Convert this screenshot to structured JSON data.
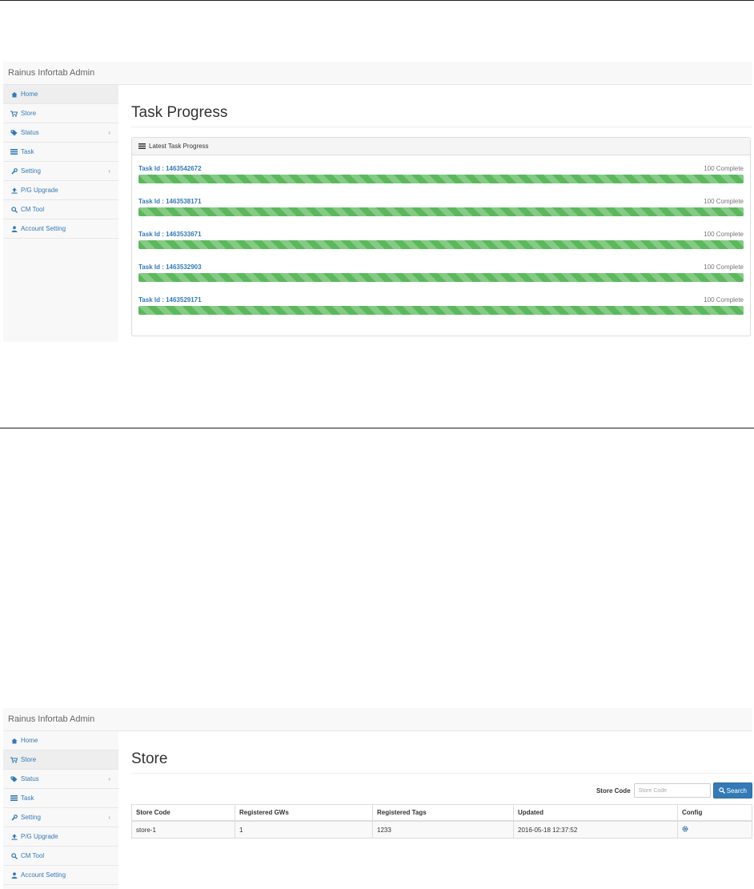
{
  "colors": {
    "accent": "#337ab7",
    "success": "#5cb85c",
    "navbar_bg": "#f8f8f8"
  },
  "task_screen": {
    "brand": "Rainus Infortab Admin",
    "sidebar": [
      {
        "label": "Home",
        "icon": "home-icon",
        "active": true
      },
      {
        "label": "Store",
        "icon": "cart-icon"
      },
      {
        "label": "Status",
        "icon": "tag-icon",
        "chevron": "‹"
      },
      {
        "label": "Task",
        "icon": "list-icon"
      },
      {
        "label": "Setting",
        "icon": "wrench-icon",
        "chevron": "‹"
      },
      {
        "label": "P/G Upgrade",
        "icon": "upload-icon"
      },
      {
        "label": "CM Tool",
        "icon": "search-icon"
      },
      {
        "label": "Account Setting",
        "icon": "user-icon"
      }
    ],
    "page_title": "Task Progress",
    "panel_title": "Latest Task Progress",
    "tasks": [
      {
        "id_label": "Task Id : 1463542672",
        "status": "100 Complete",
        "progress": 100
      },
      {
        "id_label": "Task Id : 1463538171",
        "status": "100 Complete",
        "progress": 100
      },
      {
        "id_label": "Task Id : 1463533671",
        "status": "100 Complete",
        "progress": 100
      },
      {
        "id_label": "Task Id : 1463532903",
        "status": "100 Complete",
        "progress": 100
      },
      {
        "id_label": "Task Id : 1463529171",
        "status": "100 Complete",
        "progress": 100
      }
    ]
  },
  "store_screen": {
    "brand": "Rainus Infortab Admin",
    "sidebar": [
      {
        "label": "Home",
        "icon": "home-icon"
      },
      {
        "label": "Store",
        "icon": "cart-icon",
        "active": true
      },
      {
        "label": "Status",
        "icon": "tag-icon",
        "chevron": "‹"
      },
      {
        "label": "Task",
        "icon": "list-icon"
      },
      {
        "label": "Setting",
        "icon": "wrench-icon",
        "chevron": "‹"
      },
      {
        "label": "P/G Upgrade",
        "icon": "upload-icon"
      },
      {
        "label": "CM Tool",
        "icon": "search-icon"
      },
      {
        "label": "Account Setting",
        "icon": "user-icon"
      }
    ],
    "page_title": "Store",
    "search": {
      "label": "Store Code",
      "placeholder": "Store Code",
      "value": "",
      "button": "Search"
    },
    "table": {
      "columns": [
        "Store Code",
        "Registered GWs",
        "Registered Tags",
        "Updated",
        "Config"
      ],
      "rows": [
        {
          "store_code": "store-1",
          "gws": "1",
          "tags": "1233",
          "updated": "2016-05-18 12:37:52",
          "config_icon": "gear-icon"
        }
      ]
    }
  }
}
